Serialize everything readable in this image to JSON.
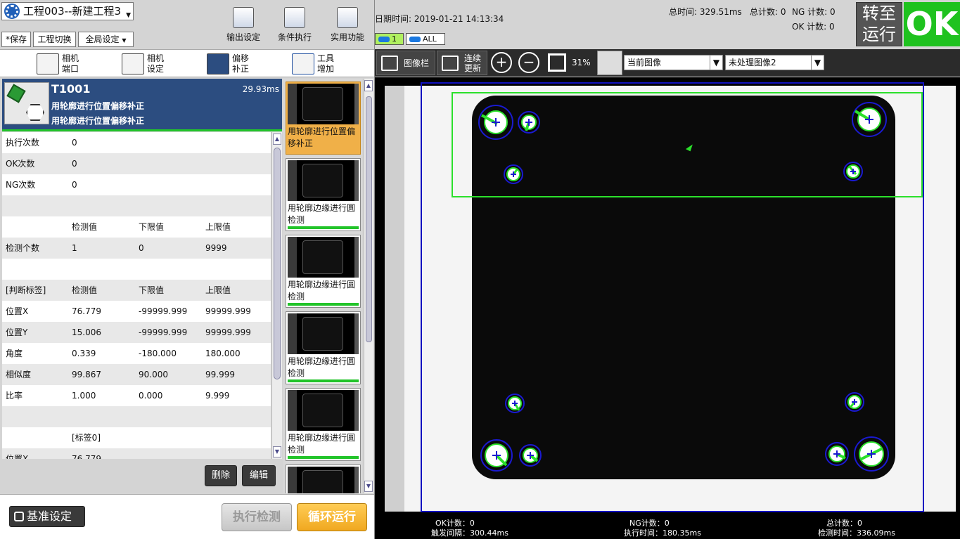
{
  "project": {
    "title": "工程003--新建工程3"
  },
  "menu": {
    "save": "*保存",
    "switch": "工程切换",
    "global": "全局设定"
  },
  "top_buttons": {
    "output": "输出设定",
    "condition": "条件执行",
    "utility": "实用功能"
  },
  "tools": [
    {
      "line1": "相机",
      "line2": "端口"
    },
    {
      "line1": "相机",
      "line2": "设定"
    },
    {
      "line1": "偏移",
      "line2": "补正"
    },
    {
      "line1": "工具",
      "line2": "增加"
    }
  ],
  "card": {
    "id": "T1001",
    "time": "29.93ms",
    "line1": "用轮廓进行位置偏移补正",
    "line2": "用轮廓进行位置偏移补正"
  },
  "table": {
    "rows": [
      {
        "c0": "执行次数",
        "c1": "0",
        "c2": "",
        "c3": ""
      },
      {
        "c0": "OK次数",
        "c1": "0",
        "c2": "",
        "c3": ""
      },
      {
        "c0": "NG次数",
        "c1": "0",
        "c2": "",
        "c3": ""
      },
      {
        "c0": "",
        "c1": "",
        "c2": "",
        "c3": ""
      },
      {
        "c0": "",
        "c1": "检测值",
        "c2": "下限值",
        "c3": "上限值"
      },
      {
        "c0": "检测个数",
        "c1": "1",
        "c2": "0",
        "c3": "9999"
      },
      {
        "c0": "",
        "c1": "",
        "c2": "",
        "c3": ""
      },
      {
        "c0": "[判断标签]",
        "c1": "检测值",
        "c2": "下限值",
        "c3": "上限值"
      },
      {
        "c0": "位置X",
        "c1": "76.779",
        "c2": "-99999.999",
        "c3": "99999.999"
      },
      {
        "c0": "位置Y",
        "c1": "15.006",
        "c2": "-99999.999",
        "c3": "99999.999"
      },
      {
        "c0": "角度",
        "c1": "0.339",
        "c2": "-180.000",
        "c3": "180.000"
      },
      {
        "c0": "相似度",
        "c1": "99.867",
        "c2": "90.000",
        "c3": "99.999"
      },
      {
        "c0": "比率",
        "c1": "1.000",
        "c2": "0.000",
        "c3": "9.999"
      },
      {
        "c0": "",
        "c1": "",
        "c2": "",
        "c3": ""
      },
      {
        "c0": "",
        "c1": "[标签0]",
        "c2": "",
        "c3": ""
      },
      {
        "c0": "位置X",
        "c1": "76.779",
        "c2": "",
        "c3": ""
      }
    ]
  },
  "actions": {
    "delete": "删除",
    "edit": "编辑",
    "base": "基准设定",
    "run": "执行检测",
    "loop": "循环运行"
  },
  "thumbs": [
    {
      "label": "用轮廓进行位置偏移补正"
    },
    {
      "label": "用轮廓边缘进行圆检测"
    },
    {
      "label": "用轮廓边缘进行圆检测"
    },
    {
      "label": "用轮廓边缘进行圆检测"
    },
    {
      "label": "用轮廓边缘进行圆检测"
    }
  ],
  "info": {
    "datetime": "日期时间: 2019-01-21 14:13:34",
    "total_time": "总时间:  329.51ms",
    "total_count": "总计数: 0",
    "ng_count": "NG 计数: 0",
    "ok_count": "OK 计数: 0"
  },
  "switch": {
    "line1": "转至",
    "line2": "运行"
  },
  "result": "OK",
  "cams": {
    "one": "1",
    "all": "ALL"
  },
  "imgtool": {
    "bar": "图像栏",
    "cont1": "连续",
    "cont2": "更新",
    "zoom": "31%",
    "source": "当前图像",
    "process": "未处理图像2"
  },
  "status": {
    "ok": "OK计数：0",
    "trigger": "触发间隔：300.44ms",
    "ng": "NG计数：0",
    "exec": "执行时间：180.35ms",
    "total": "总计数：0",
    "detect": "检测时间：336.09ms"
  },
  "colors": {
    "ok_green": "#1fc21f",
    "accent_orange": "#f0a820",
    "header_blue": "#2c4d80"
  }
}
